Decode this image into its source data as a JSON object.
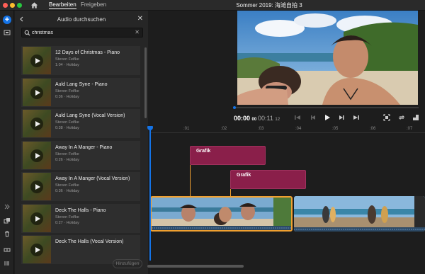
{
  "window": {
    "title": "Sommer 2019: 海滩自拍 3",
    "tabs": [
      {
        "label": "Bearbeiten",
        "active": true
      },
      {
        "label": "Freigeben",
        "active": false
      }
    ],
    "traffic_colors": [
      "#ff5f57",
      "#febc2e",
      "#28c840"
    ]
  },
  "audio_panel": {
    "title": "Audio durchsuchen",
    "search": {
      "value": "christmas",
      "placeholder": "Suchen"
    },
    "items": [
      {
        "title": "12 Days of Christmas - Piano",
        "artist": "Steven Feifke",
        "meta": "1:04 · Holiday"
      },
      {
        "title": "Auld Lang Syne - Piano",
        "artist": "Steven Feifke",
        "meta": "0:36 · Holiday"
      },
      {
        "title": "Auld Lang Syne (Vocal Version)",
        "artist": "Steven Feifke",
        "meta": "0:38 · Holiday"
      },
      {
        "title": "Away In A Manger - Piano",
        "artist": "Steven Feifke",
        "meta": "0:26 · Holiday"
      },
      {
        "title": "Away In A Manger (Vocal Version)",
        "artist": "Steven Feifke",
        "meta": "0:36 · Holiday"
      },
      {
        "title": "Deck The Halls - Piano",
        "artist": "Steven Feifke",
        "meta": "0:27 · Holiday"
      },
      {
        "title": "Deck The Halls (Vocal Version)",
        "artist": "",
        "meta": ""
      }
    ],
    "add_label": "Hinzufügen"
  },
  "player": {
    "current_time": "00:00",
    "current_frames": "00",
    "duration": "00:11",
    "duration_frames": "12"
  },
  "timeline": {
    "ticks": [
      ":01",
      ":02",
      ":03",
      ":04",
      ":05",
      ":06",
      ":07"
    ],
    "graphic_clips": [
      "Grafik",
      "Grafik"
    ]
  },
  "colors": {
    "accent": "#1473e6",
    "graphic_clip": "#8a1f4a",
    "selected_clip": "#f0a030"
  }
}
